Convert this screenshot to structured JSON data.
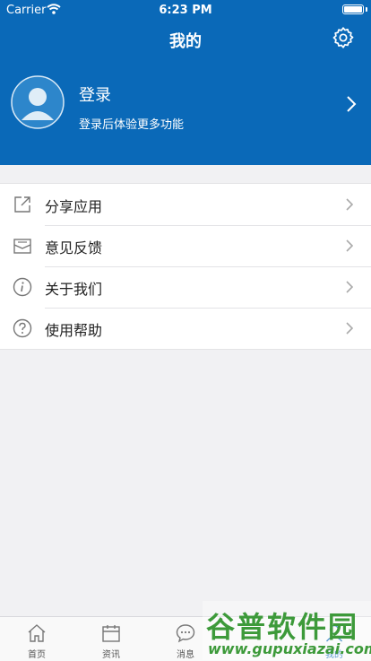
{
  "status_bar": {
    "carrier": "Carrier",
    "time": "6:23 PM"
  },
  "header": {
    "title": "我的"
  },
  "profile": {
    "title": "登录",
    "subtitle": "登录后体验更多功能"
  },
  "menu": {
    "items": [
      {
        "label": "分享应用",
        "icon": "share-icon"
      },
      {
        "label": "意见反馈",
        "icon": "mail-icon"
      },
      {
        "label": "关于我们",
        "icon": "info-icon"
      },
      {
        "label": "使用帮助",
        "icon": "help-icon"
      }
    ]
  },
  "tabbar": {
    "items": [
      {
        "label": "首页",
        "icon": "home-icon"
      },
      {
        "label": "资讯",
        "icon": "calendar-icon"
      },
      {
        "label": "消息",
        "icon": "chat-icon"
      },
      {
        "label": "",
        "icon": ""
      },
      {
        "label": "我的",
        "icon": "person-icon"
      }
    ]
  },
  "watermark": {
    "text": "谷普软件园",
    "url": "www.gupuxiazai.com"
  },
  "colors": {
    "header_bg": "#0a69b8",
    "page_bg": "#f1f1f3",
    "accent": "#0a69b8",
    "watermark": "#3d9a3a"
  }
}
